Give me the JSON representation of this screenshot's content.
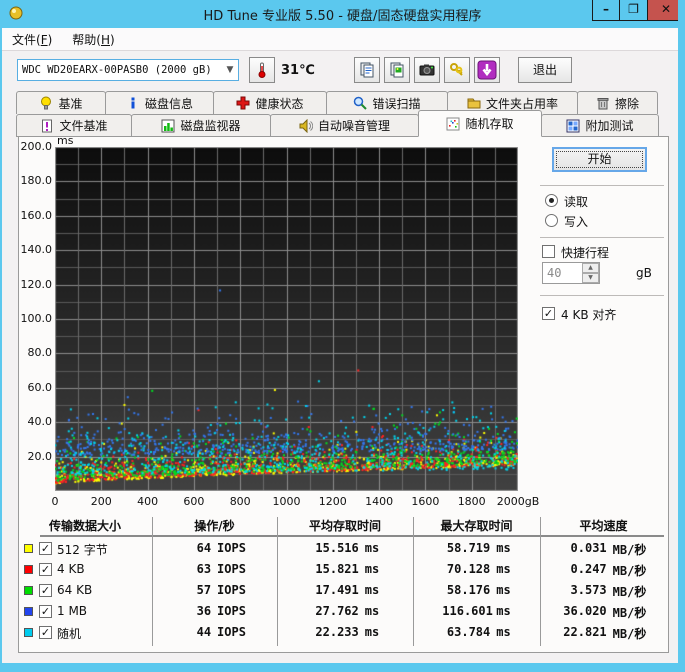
{
  "window": {
    "title": "HD Tune 专业版 5.50 - 硬盘/固态硬盘实用程序",
    "controls": {
      "minimize": "–",
      "maximize": "❐",
      "close": "✕"
    }
  },
  "menu": {
    "items": [
      {
        "pre": "文件(",
        "key": "F",
        "post": ")"
      },
      {
        "pre": "帮助(",
        "key": "H",
        "post": ")"
      }
    ]
  },
  "toolbar": {
    "drive": "WDC WD20EARX-00PASB0 (2000 gB)",
    "dropdown_arrow": "▼",
    "temperature": "31℃",
    "exit": "退出"
  },
  "tabs": {
    "selected": "随机存取",
    "row1": [
      {
        "label": "基准"
      },
      {
        "label": "磁盘信息"
      },
      {
        "label": "健康状态"
      },
      {
        "label": "错误扫描"
      },
      {
        "label": "文件夹占用率"
      },
      {
        "label": "擦除"
      }
    ],
    "row2": [
      {
        "label": "文件基准"
      },
      {
        "label": "磁盘监视器"
      },
      {
        "label": "自动噪音管理"
      },
      {
        "label": "随机存取"
      },
      {
        "label": "附加测试"
      }
    ]
  },
  "controls": {
    "start": "开始",
    "read": "读取",
    "write": "写入",
    "read_selected": true,
    "short_stroke": "快捷行程",
    "short_stroke_checked": false,
    "capacity_value": "40",
    "capacity_unit": "gB",
    "spin_up": "▲",
    "spin_down": "▼",
    "align": "4 KB 对齐",
    "align_checked": true,
    "check_glyph": "✓"
  },
  "table": {
    "headers": [
      "传输数据大小",
      "操作/秒",
      "平均存取时间",
      "最大存取时间",
      "平均速度"
    ],
    "units": {
      "iops": "IOPS",
      "time": "ms",
      "speed": "MB/秒"
    },
    "rows": [
      {
        "label": "512 字节",
        "color": "#ffff00",
        "checked": true,
        "iops": "64",
        "avg": "15.516",
        "max": "58.719",
        "speed": "0.031"
      },
      {
        "label": "4 KB",
        "color": "#ff0000",
        "checked": true,
        "iops": "63",
        "avg": "15.821",
        "max": "70.128",
        "speed": "0.247"
      },
      {
        "label": "64 KB",
        "color": "#00dd00",
        "checked": true,
        "iops": "57",
        "avg": "17.491",
        "max": "58.176",
        "speed": "3.573"
      },
      {
        "label": "1 MB",
        "color": "#2244ee",
        "checked": true,
        "iops": "36",
        "avg": "27.762",
        "max": "116.601",
        "speed": "36.020"
      },
      {
        "label": "随机",
        "color": "#00ccee",
        "checked": true,
        "iops": "44",
        "avg": "22.233",
        "max": "63.784",
        "speed": "22.821"
      }
    ]
  },
  "chart_data": {
    "type": "scatter",
    "title": "",
    "xlabel": "gB",
    "ylabel": "ms",
    "xlim": [
      0,
      2000
    ],
    "ylim": [
      0,
      200
    ],
    "grid": {
      "x_step": 100,
      "y_step": 10,
      "minor_color": "#5a5a5a",
      "major_color": "#8c8c8c"
    },
    "bg_top": "#0d0d0d",
    "bg_bottom": "#414141",
    "y_ticks": [
      {
        "v": 200,
        "label": "200.0"
      },
      {
        "v": 180,
        "label": "180.0"
      },
      {
        "v": 160,
        "label": "160.0"
      },
      {
        "v": 140,
        "label": "140.0"
      },
      {
        "v": 120,
        "label": "120.0"
      },
      {
        "v": 100,
        "label": "100.0"
      },
      {
        "v": 80,
        "label": "80.0"
      },
      {
        "v": 60,
        "label": "60.0"
      },
      {
        "v": 40,
        "label": "40.0"
      },
      {
        "v": 20,
        "label": "20.0"
      }
    ],
    "x_ticks": [
      {
        "v": 0,
        "label": "0"
      },
      {
        "v": 200,
        "label": "200"
      },
      {
        "v": 400,
        "label": "400"
      },
      {
        "v": 600,
        "label": "600"
      },
      {
        "v": 800,
        "label": "800"
      },
      {
        "v": 1000,
        "label": "1000"
      },
      {
        "v": 1200,
        "label": "1200"
      },
      {
        "v": 1400,
        "label": "1400"
      },
      {
        "v": 1600,
        "label": "1600"
      },
      {
        "v": 1800,
        "label": "1800"
      },
      {
        "v": 2000,
        "label": "2000gB"
      }
    ],
    "floor": {
      "a": 3.5,
      "b": 10.5,
      "p": 0.8
    },
    "series": [
      {
        "name": "512 字节",
        "color": "#ffff00",
        "seed": 11,
        "count": 620,
        "dist": "floor",
        "off": 0.8,
        "scale": 4.2,
        "clip": 46,
        "outliers": [
          [
            950,
            58.7
          ],
          [
            300,
            50
          ],
          [
            1650,
            44
          ]
        ],
        "avg_ms": 15.516,
        "max_ms": 58.719,
        "iops": 64
      },
      {
        "name": "4 KB",
        "color": "#ff2222",
        "seed": 22,
        "count": 620,
        "dist": "floor",
        "off": 1.1,
        "scale": 4.6,
        "clip": 50,
        "outliers": [
          [
            1310,
            70.1
          ],
          [
            620,
            47
          ]
        ],
        "avg_ms": 15.821,
        "max_ms": 70.128,
        "iops": 63
      },
      {
        "name": "64 KB",
        "color": "#00dd22",
        "seed": 33,
        "count": 600,
        "dist": "floor",
        "off": 2.2,
        "scale": 5.5,
        "clip": 52,
        "outliers": [
          [
            420,
            58.2
          ],
          [
            1500,
            44
          ]
        ],
        "avg_ms": 17.491,
        "max_ms": 58.176,
        "iops": 57
      },
      {
        "name": "1 MB",
        "color": "#3377ee",
        "seed": 44,
        "count": 540,
        "dist": "band",
        "a": 20.5,
        "b": 3.5,
        "scale": 6.2,
        "clip": 55,
        "outliers": [
          [
            713,
            116.6
          ],
          [
            1050,
            52
          ]
        ],
        "avg_ms": 27.762,
        "max_ms": 116.601,
        "iops": 36
      },
      {
        "name": "随机",
        "color": "#00d5ee",
        "seed": 55,
        "count": 540,
        "dist": "band",
        "a": 9.5,
        "b": 3.0,
        "scale": 10.0,
        "clip": 52,
        "outliers": [
          [
            1140,
            63.8
          ]
        ],
        "avg_ms": 22.233,
        "max_ms": 63.784,
        "iops": 44
      }
    ]
  }
}
